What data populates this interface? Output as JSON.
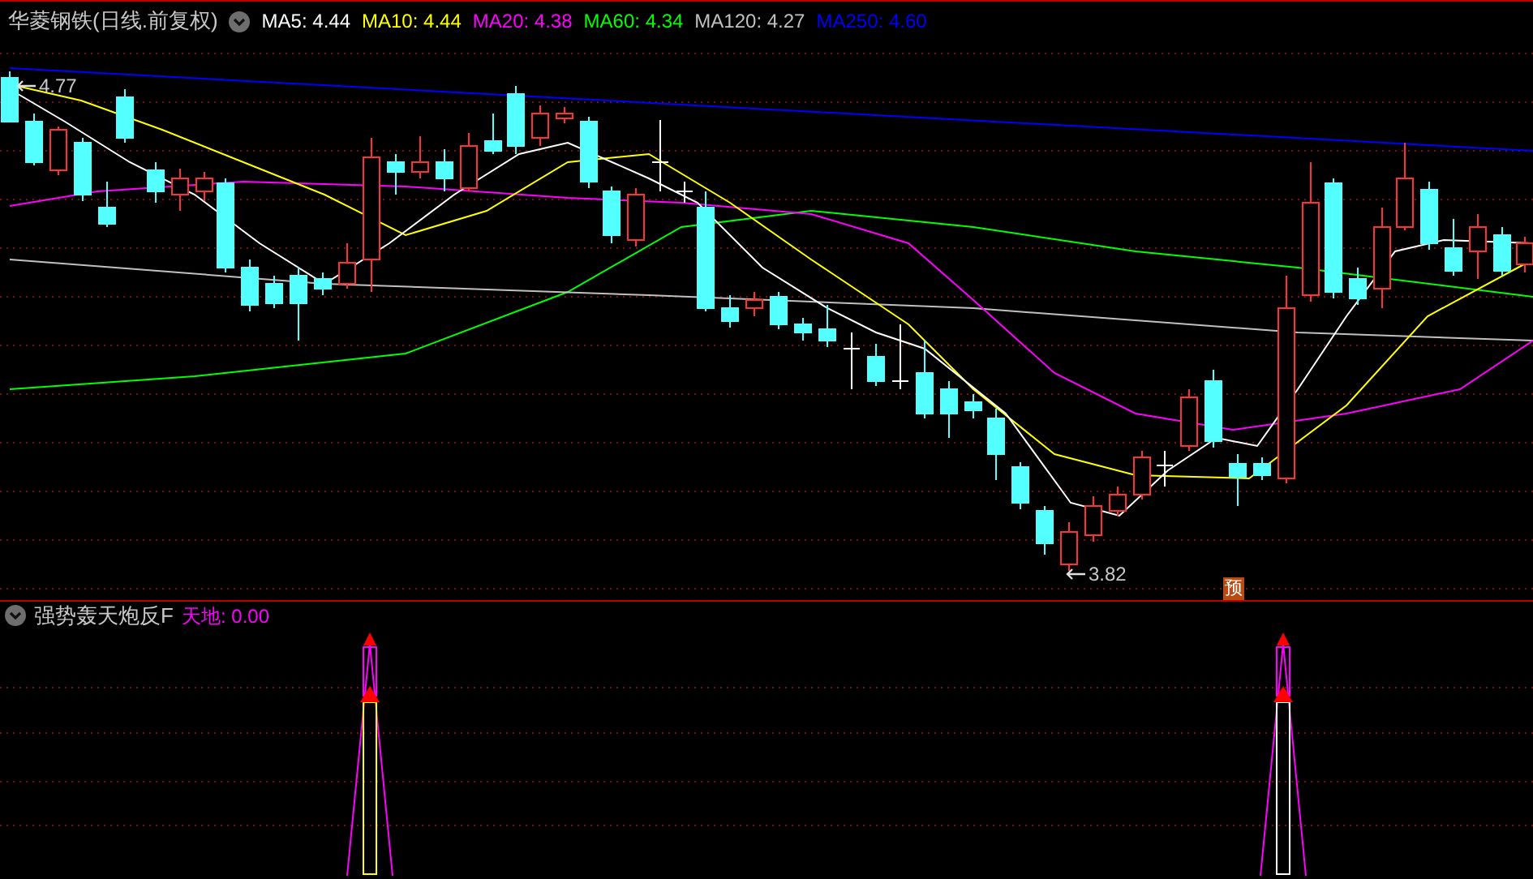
{
  "chart": {
    "title": "华菱钢铁(日线.前复权)",
    "ma_legend": [
      {
        "label": "MA5:",
        "value": "4.44",
        "color": "#ffffff"
      },
      {
        "label": "MA10:",
        "value": "4.44",
        "color": "#ffff00"
      },
      {
        "label": "MA20:",
        "value": "4.38",
        "color": "#ff00ff"
      },
      {
        "label": "MA60:",
        "value": "4.34",
        "color": "#00ff00"
      },
      {
        "label": "MA120:",
        "value": "4.27",
        "color": "#c0c0c0"
      },
      {
        "label": "MA250:",
        "value": "4.60",
        "color": "#0000ff"
      }
    ],
    "high_label": "4.77",
    "low_label": "3.82",
    "badge": "预"
  },
  "indicator": {
    "name": "强势轰天炮反F",
    "legend": [
      {
        "label": "天地:",
        "value": "0.00",
        "color": "#ff00ff"
      }
    ]
  }
}
